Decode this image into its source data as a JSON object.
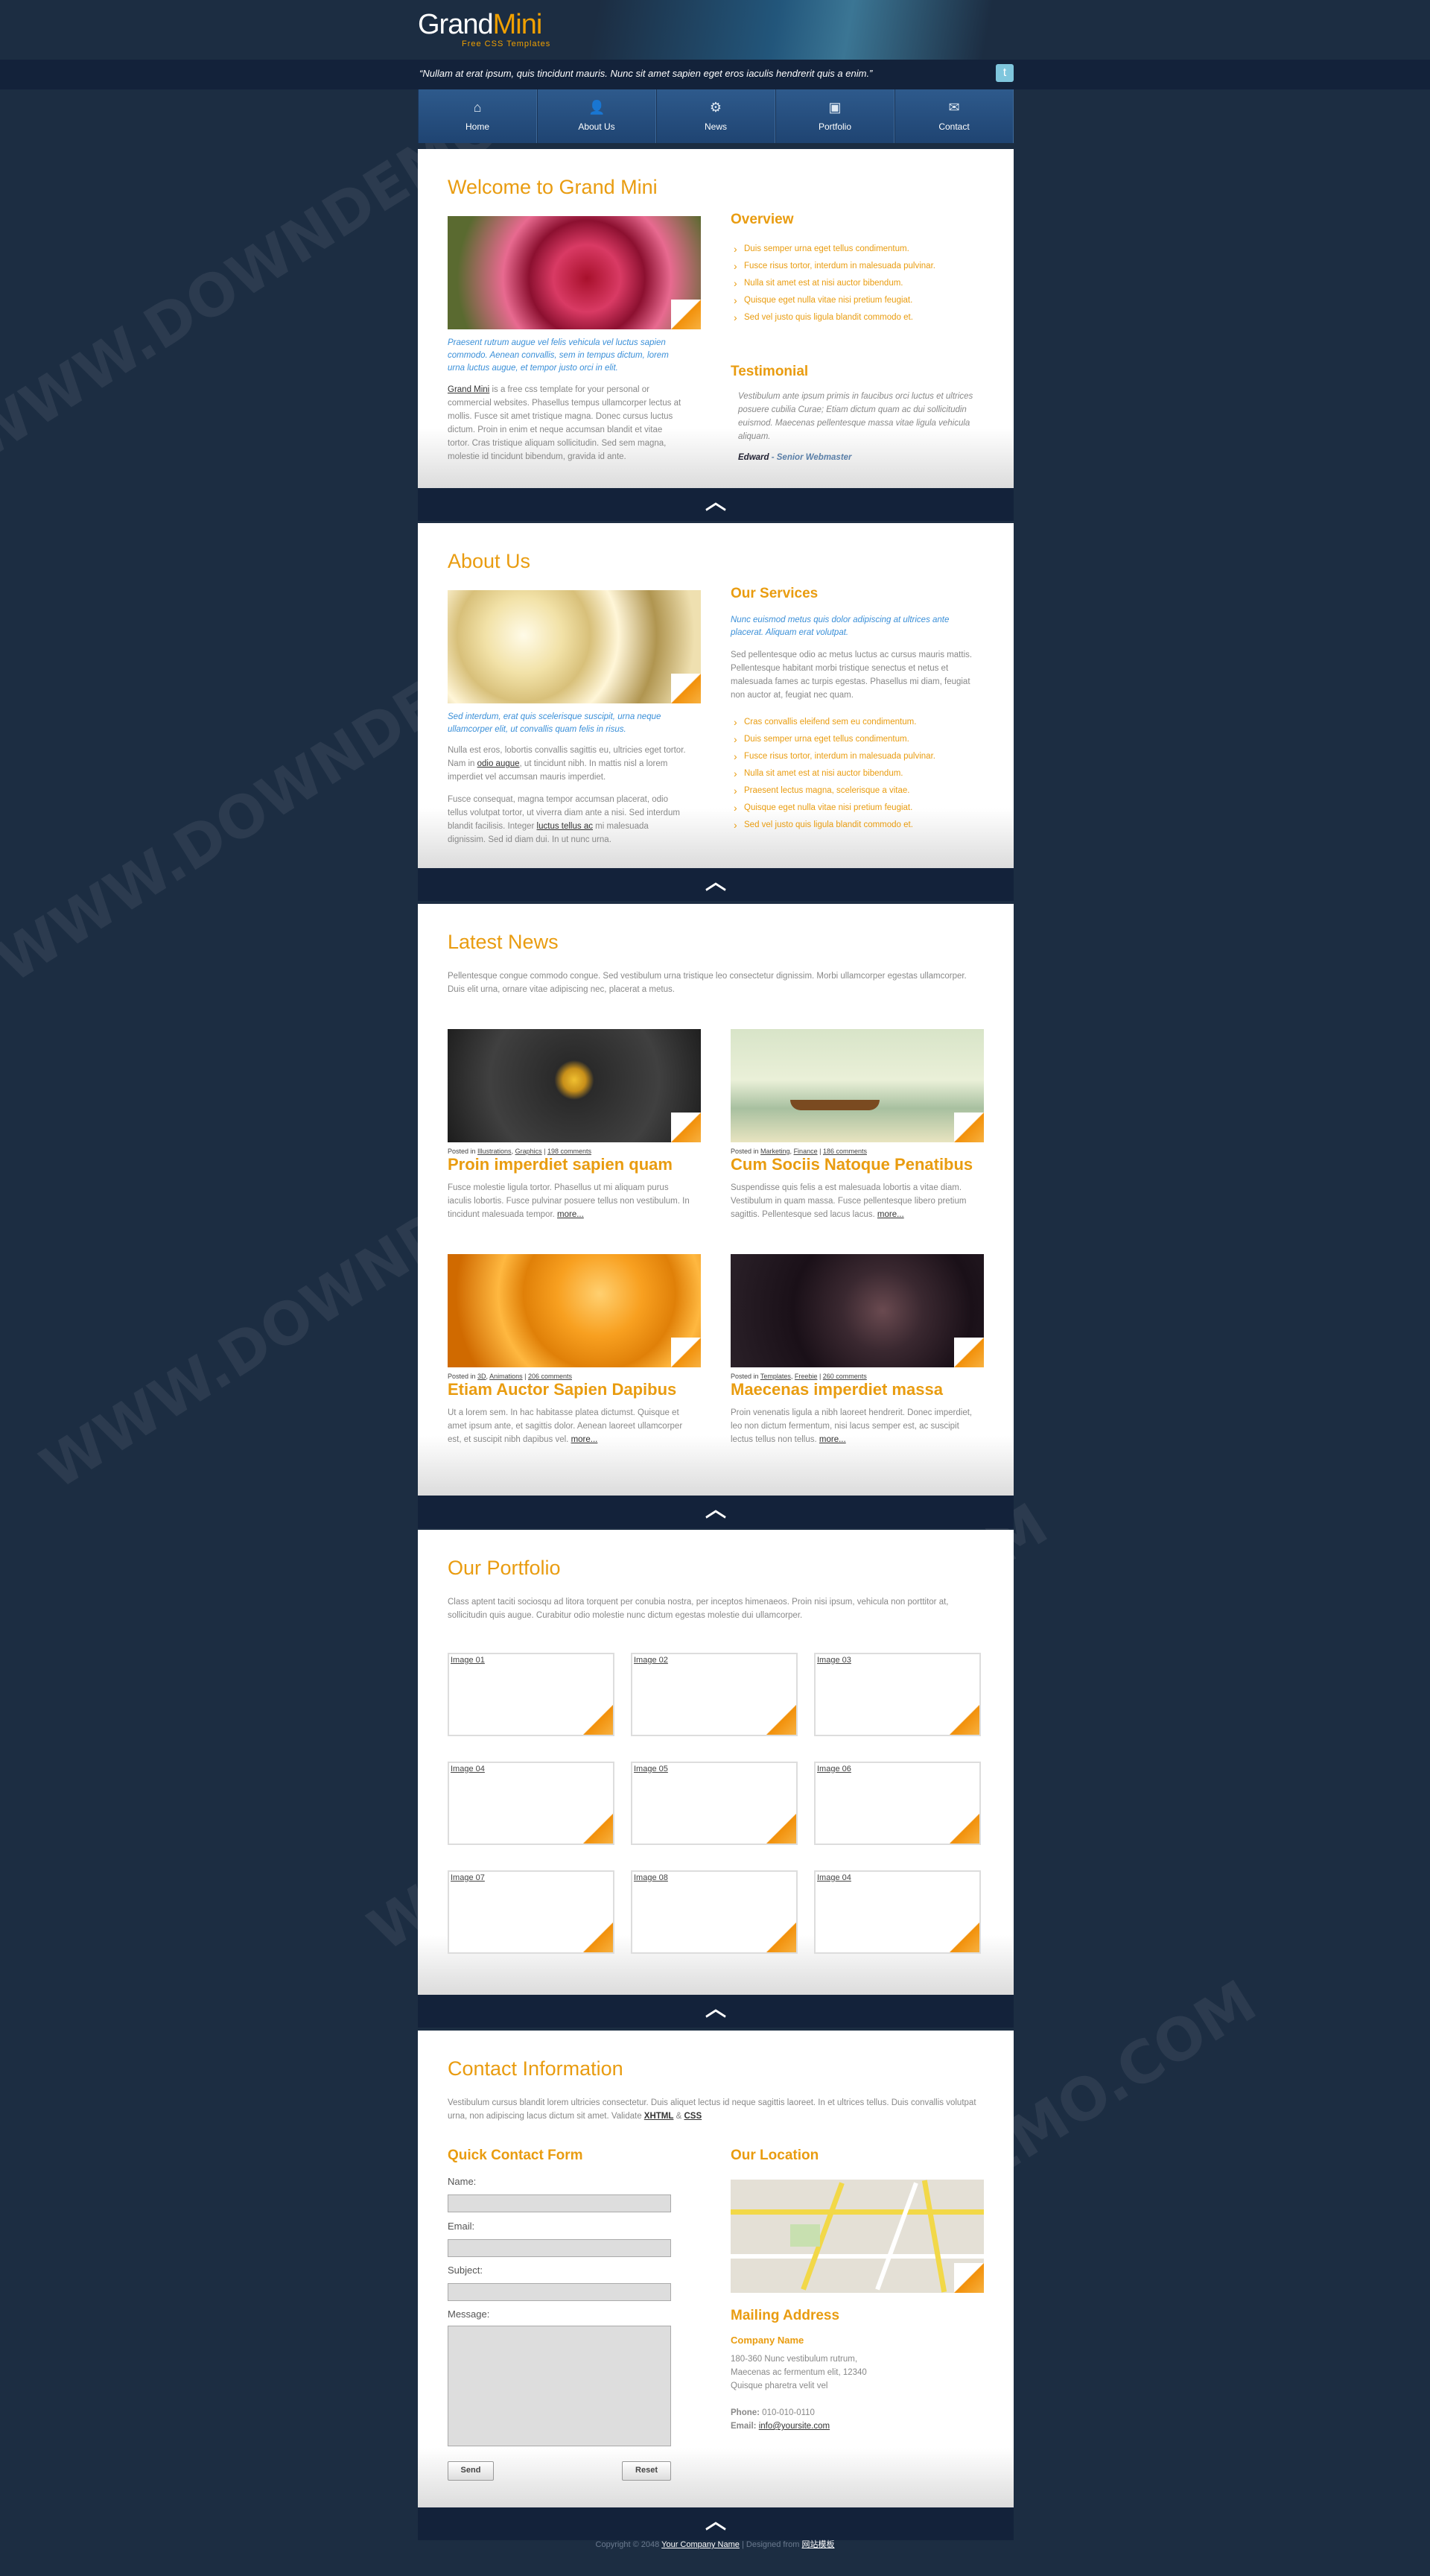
{
  "brand": {
    "name_a": "Grand",
    "name_b": "Mini",
    "tagline": "Free CSS Templates"
  },
  "quote": "“Nullam at erat ipsum, quis tincidunt mauris. Nunc sit amet sapien eget eros iaculis hendrerit quis a enim.”",
  "nav": [
    {
      "label": "Home",
      "icon": "⌂"
    },
    {
      "label": "About Us",
      "icon": "👤"
    },
    {
      "label": "News",
      "icon": "⚙"
    },
    {
      "label": "Portfolio",
      "icon": "▣"
    },
    {
      "label": "Contact",
      "icon": "✉"
    }
  ],
  "welcome": {
    "title": "Welcome to Grand Mini",
    "caption": "Praesent rutrum augue vel felis vehicula vel luctus sapien commodo. Aenean convallis, sem in tempus dictum, lorem urna luctus augue, et tempor justo orci in elit.",
    "body_link": "Grand Mini",
    "body": " is a free css template for your personal or commercial websites. Phasellus tempus ullamcorper lectus at mollis. Fusce sit amet tristique magna. Donec cursus luctus dictum. Proin in enim et neque accumsan blandit et vitae tortor. Cras tristique aliquam sollicitudin. Sed sem magna, molestie id tincidunt bibendum, gravida id ante.",
    "overview_title": "Overview",
    "overview": [
      "Duis semper urna eget tellus condimentum.",
      "Fusce risus tortor, interdum in malesuada pulvinar.",
      "Nulla sit amet est at nisi auctor bibendum.",
      "Quisque eget nulla vitae nisi pretium feugiat.",
      "Sed vel justo quis ligula blandit commodo et."
    ],
    "testimonial_title": "Testimonial",
    "testimonial": "Vestibulum ante ipsum primis in faucibus orci luctus et ultrices posuere cubilia Curae; Etiam dictum quam ac dui sollicitudin euismod. Maecenas pellentesque massa vitae ligula vehicula aliquam.",
    "author": "Edward",
    "author_role": " - Senior Webmaster"
  },
  "about": {
    "title": "About Us",
    "caption": "Sed interdum, erat quis scelerisque suscipit, urna neque ullamcorper elit, ut convallis quam felis in risus.",
    "p1a": "Nulla est eros, lobortis convallis sagittis eu, ultricies eget tortor. Nam in ",
    "p1link": "odio augue",
    "p1b": ", ut tincidunt nibh. In mattis nisl a lorem imperdiet vel accumsan mauris imperdiet.",
    "p2a": "Fusce consequat, magna tempor accumsan placerat, odio tellus volutpat tortor, ut viverra diam ante a nisi. Sed interdum blandit facilisis. Integer ",
    "p2link": "luctus tellus ac",
    "p2b": " mi malesuada dignissim. Sed id diam dui. In ut nunc urna.",
    "services_title": "Our Services",
    "services_lead": "Nunc euismod metus quis dolor adipiscing at ultrices ante placerat. Aliquam erat volutpat.",
    "services_body": "Sed pellentesque odio ac metus luctus ac cursus mauris mattis. Pellentesque habitant morbi tristique senectus et netus et malesuada fames ac turpis egestas. Phasellus mi diam, feugiat non auctor at, feugiat nec quam.",
    "services": [
      "Cras convallis eleifend sem eu condimentum.",
      "Duis semper urna eget tellus condimentum.",
      "Fusce risus tortor, interdum in malesuada pulvinar.",
      "Nulla sit amet est at nisi auctor bibendum.",
      "Praesent lectus magna, scelerisque a vitae.",
      "Quisque eget nulla vitae nisi pretium feugiat.",
      "Sed vel justo quis ligula blandit commodo et."
    ]
  },
  "news": {
    "title": "Latest News",
    "intro": "Pellentesque congue commodo congue. Sed vestibulum urna tristique leo consectetur dignissim. Morbi ullamcorper egestas ullamcorper. Duis elit urna, ornare vitae adipiscing nec, placerat a metus.",
    "posted_in": "Posted in ",
    "more": "more...",
    "items": [
      {
        "cats": [
          "Illustrations",
          "Graphics"
        ],
        "comments": "198 comments",
        "title": "Proin imperdiet sapien quam",
        "body": "Fusce molestie ligula tortor. Phasellus ut mi aliquam purus iaculis lobortis. Fusce pulvinar posuere tellus non vestibulum. In tincidunt malesuada tempor. "
      },
      {
        "cats": [
          "Marketing",
          "Finance"
        ],
        "comments": "186 comments",
        "title": "Cum Sociis Natoque Penatibus",
        "body": "Suspendisse quis felis a est malesuada lobortis a vitae diam. Vestibulum in quam massa. Fusce pellentesque libero pretium sagittis. Pellentesque sed lacus lacus. "
      },
      {
        "cats": [
          "3D",
          "Animations"
        ],
        "comments": "206 comments",
        "title": "Etiam Auctor Sapien Dapibus",
        "body": "Ut a lorem sem. In hac habitasse platea dictumst. Quisque et amet ipsum ante, et sagittis dolor. Aenean laoreet ullamcorper est, et suscipit nibh dapibus vel. "
      },
      {
        "cats": [
          "Templates",
          "Freebie"
        ],
        "comments": "260 comments",
        "title": "Maecenas imperdiet massa",
        "body": "Proin venenatis ligula a nibh laoreet hendrerit. Donec imperdiet, leo non dictum fermentum, nisi lacus semper est, ac suscipit lectus tellus non tellus. "
      }
    ]
  },
  "portfolio": {
    "title": "Our Portfolio",
    "intro": "Class aptent taciti sociosqu ad litora torquent per conubia nostra, per inceptos himenaeos. Proin nisi ipsum, vehicula non porttitor at, sollicitudin quis augue. Curabitur odio molestie nunc dictum egestas molestie dui ullamcorper.",
    "items": [
      "Image 01",
      "Image 02",
      "Image 03",
      "Image 04",
      "Image 05",
      "Image 06",
      "Image 07",
      "Image 08",
      "Image 04"
    ]
  },
  "contact": {
    "title": "Contact Information",
    "intro": "Vestibulum cursus blandit lorem ultricies consectetur. Duis aliquet lectus id neque sagittis laoreet. In et ultrices tellus. Duis convallis volutpat urna, non adipiscing lacus dictum sit amet. Validate ",
    "xhtml": "XHTML",
    "and": " & ",
    "css": "CSS",
    "form_title": "Quick Contact Form",
    "name_label": "Name:",
    "email_label": "Email:",
    "subject_label": "Subject:",
    "message_label": "Message:",
    "send": "Send",
    "reset": "Reset",
    "location_title": "Our Location",
    "mailing_title": "Mailing Address",
    "company": "Company Name",
    "addr1": "180-360 Nunc vestibulum rutrum,",
    "addr2": "Maecenas ac fermentum elit, 12340",
    "addr3": "Quisque pharetra velit vel",
    "phone_label": "Phone:",
    "phone": " 010-010-0110",
    "email_label2": "Email:",
    "email": "info@yoursite.com"
  },
  "footer": {
    "copy": "Copyright © 2048 ",
    "company": "Your Company Name",
    "designed": " | Designed from ",
    "designer": "网站模板"
  },
  "watermark": "WWW.DOWNDEMO.COM"
}
